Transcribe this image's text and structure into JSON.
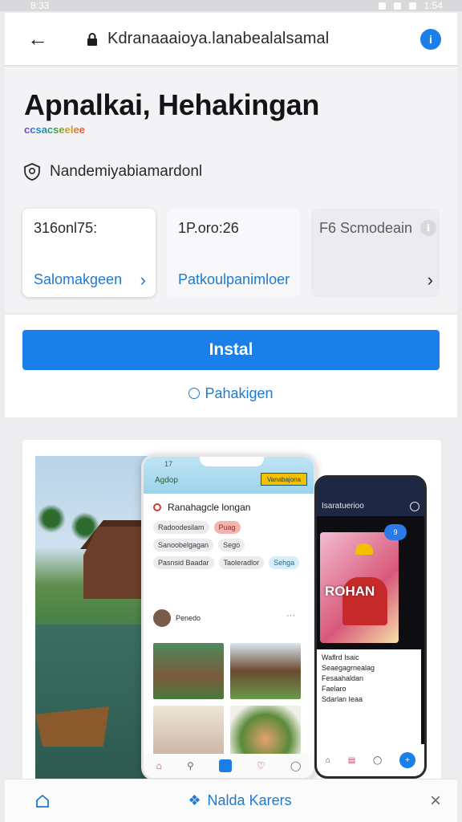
{
  "status_bar": {
    "time": "8:33",
    "battery": "1:54"
  },
  "browser": {
    "url": "Kdranaaaioya.lanabealalsamal",
    "info_label": "i"
  },
  "app": {
    "title": "Apnalkai, Hehakingan",
    "tagline": "ccsacseelee",
    "publisher": "Nandemiyabiamardonl",
    "stats": [
      {
        "value": "316onl75:",
        "label": "Salomakgeen"
      },
      {
        "value": "1P.oro:26",
        "label": "Patkoulpanimloer"
      },
      {
        "value": "F6 Scmodeain",
        "label": ""
      }
    ],
    "install_label": "Instal",
    "secondary_label": "Pahakigen"
  },
  "screenshots": {
    "main_phone": {
      "time": "17",
      "app_name": "Agdop",
      "badge": "Vanabajona",
      "heading": "Ranahagcle longan",
      "chips": [
        "Radoodesilam",
        "Puag",
        "Sanoobelgagan",
        "Sego",
        "Pasnsid Baadar",
        "Taoleradlor",
        "Sehga"
      ],
      "post_name": "Penedo",
      "more": "···"
    },
    "dark_phone": {
      "header": "Isaratuerioo",
      "banner_text": "ROHAN",
      "badge": "9",
      "lines": [
        "Waflrd Isaic",
        "Seaegagrnealag",
        "Fesaahaldan",
        "Faelaro",
        "Sdarlan Ieaa"
      ]
    }
  },
  "bottom_bar": {
    "label": "Nalda Karers",
    "close": "×"
  },
  "colors": {
    "accent": "#1a7fe8",
    "link": "#1e7ad0"
  }
}
